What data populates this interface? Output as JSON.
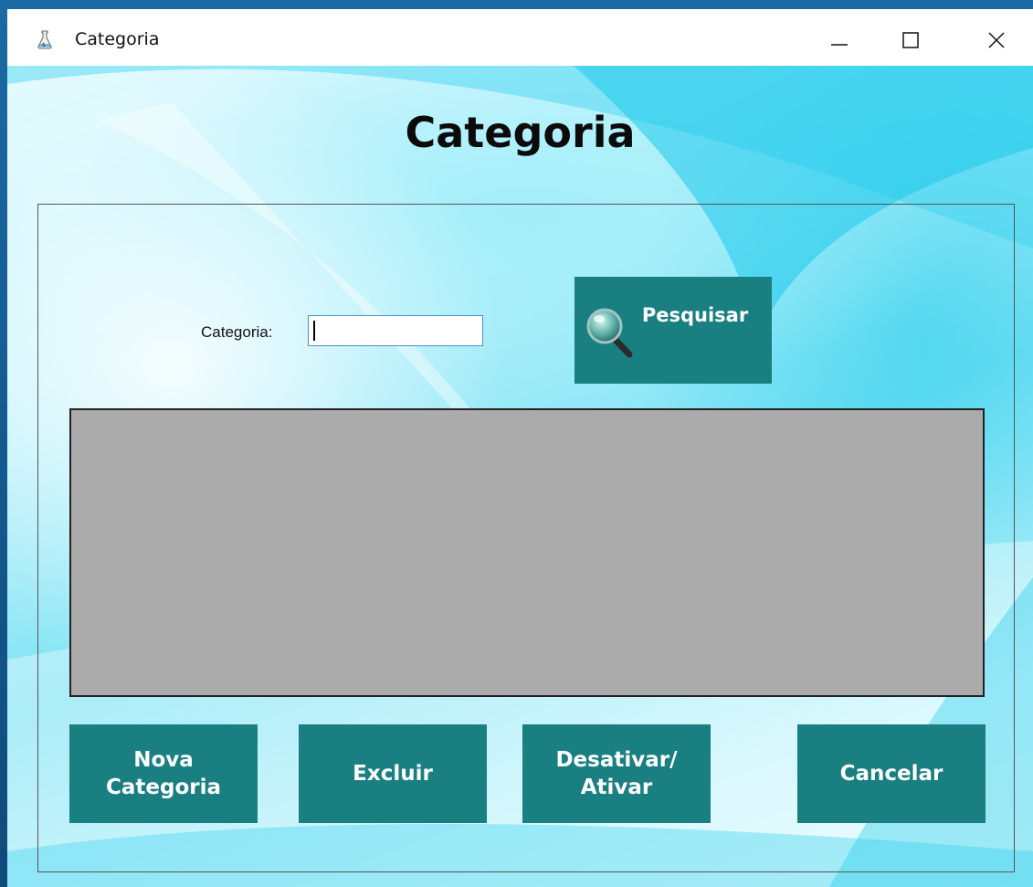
{
  "window": {
    "title": "Categoria",
    "controls": {
      "minimize": "minimize",
      "maximize": "maximize",
      "close": "close"
    }
  },
  "form": {
    "heading": "Categoria",
    "search": {
      "label": "Categoria:",
      "value": "",
      "button_label": "Pesquisar"
    },
    "buttons": {
      "new": "Nova Categoria",
      "delete": "Excluir",
      "toggle": "Desativar/ Ativar",
      "cancel": "Cancelar"
    }
  },
  "colors": {
    "button": "#1a7f80",
    "grid_background": "#ababab"
  },
  "icons": [
    "app-icon",
    "minimize-icon",
    "maximize-icon",
    "close-icon",
    "magnifier-icon"
  ]
}
